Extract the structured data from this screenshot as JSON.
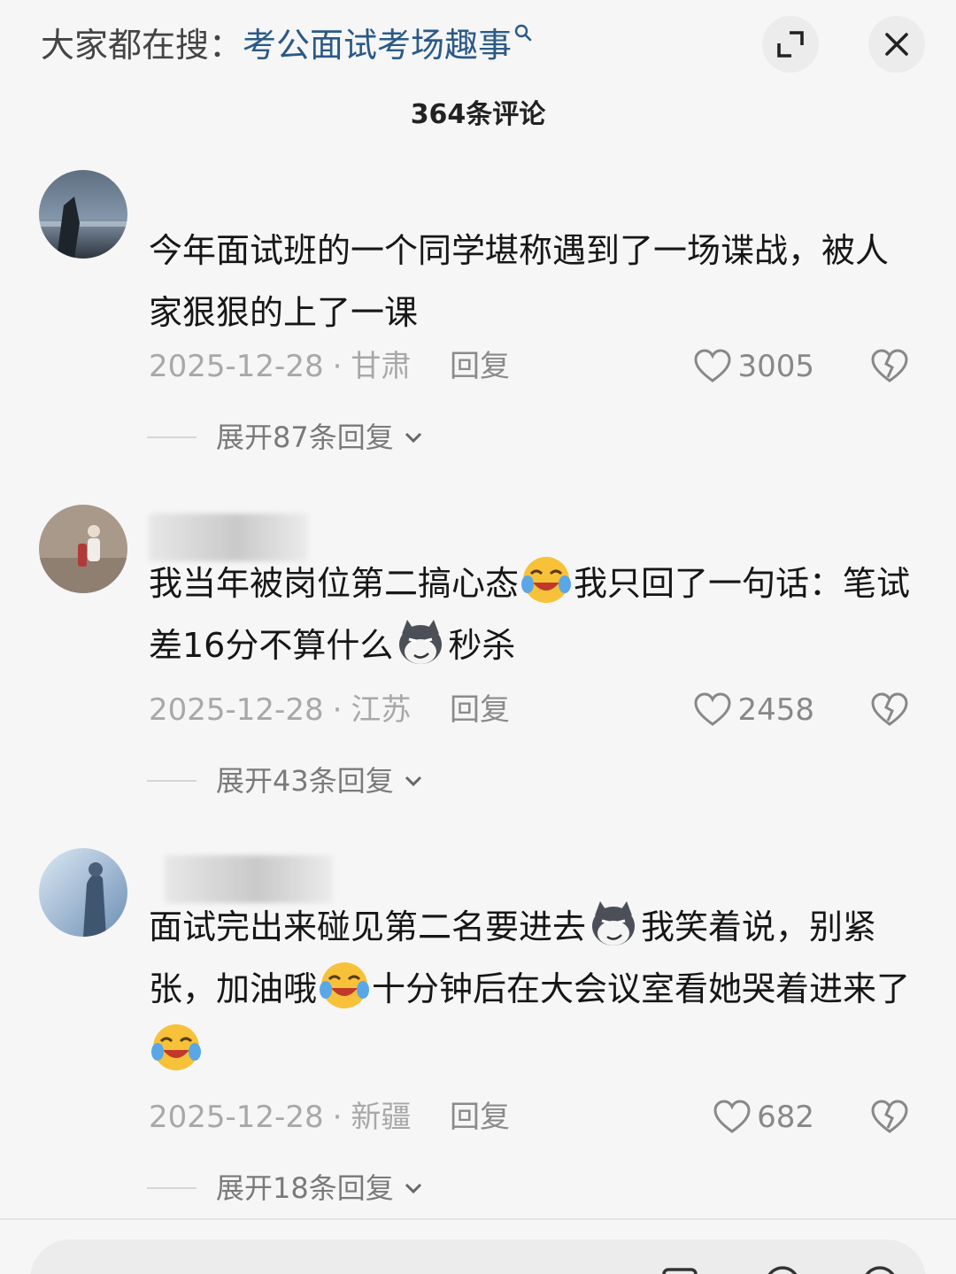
{
  "header": {
    "search_prefix": "大家都在搜：",
    "search_term": "考公面试考场趣事",
    "expand_icon": "expand-icon",
    "close_icon": "close-icon"
  },
  "comment_count": "364条评论",
  "comments": [
    {
      "text": "今年面试班的一个同学堪称遇到了一场谍战，被人家狠狠的上了一课",
      "date": "2025-12-28",
      "location": "甘肃",
      "reply_label": "回复",
      "likes": "3005",
      "expand_label": "展开87条回复"
    },
    {
      "text_parts": [
        "我当年被岗位第二搞心态",
        "我只回了一句话：笔试差16分不算什么",
        "秒杀"
      ],
      "emojis": [
        "laughing-crying-emoji",
        "smirking-dog-emoji"
      ],
      "date": "2025-12-28",
      "location": "江苏",
      "reply_label": "回复",
      "likes": "2458",
      "expand_label": "展开43条回复"
    },
    {
      "text_parts": [
        "面试完出来碰见第二名要进去",
        "我笑着说，别紧张，加油哦",
        "十分钟后在大会议室看她哭着进来了"
      ],
      "emojis": [
        "smirking-dog-emoji",
        "laughing-crying-emoji",
        "laughing-crying-emoji"
      ],
      "date": "2025-12-28",
      "location": "新疆",
      "reply_label": "回复",
      "likes": "682",
      "expand_label": "展开18条回复"
    }
  ],
  "separator": "·",
  "colors": {
    "background": "#f6f6f6",
    "search_term": "#2a5a86",
    "meta": "#a8a8a8"
  }
}
